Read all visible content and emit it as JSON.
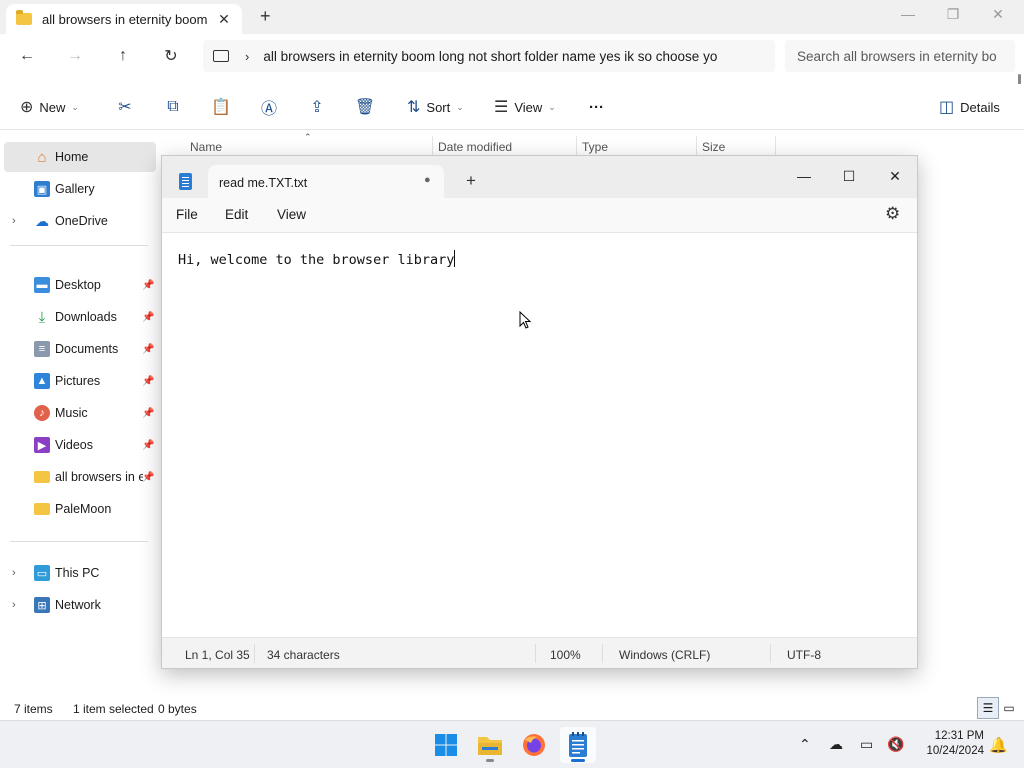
{
  "explorer": {
    "tab_title": "all browsers in eternity boom l",
    "tab_close": "✕",
    "new_tab": "+",
    "nav": {
      "back": "←",
      "forward": "→",
      "up": "↑",
      "refresh": "↻"
    },
    "address_path": "all browsers in eternity boom long not short folder name yes ik so choose yo",
    "search_placeholder": "Search all browsers in eternity bo",
    "toolbar": {
      "new_label": "New",
      "sort_label": "Sort",
      "view_label": "View",
      "more_label": "···",
      "details_label": "Details"
    },
    "sidebar": {
      "items": [
        {
          "label": "Home",
          "icon": "home-icon"
        },
        {
          "label": "Gallery",
          "icon": "gallery-icon"
        },
        {
          "label": "OneDrive",
          "icon": "onedrive-icon"
        },
        {
          "label": "Desktop",
          "icon": "desktop-icon"
        },
        {
          "label": "Downloads",
          "icon": "downloads-icon"
        },
        {
          "label": "Documents",
          "icon": "documents-icon"
        },
        {
          "label": "Pictures",
          "icon": "pictures-icon"
        },
        {
          "label": "Music",
          "icon": "music-icon"
        },
        {
          "label": "Videos",
          "icon": "videos-icon"
        },
        {
          "label": "all browsers in eternity boom long not short folder name yes ik so choose yo",
          "icon": "folder-icon"
        },
        {
          "label": "PaleMoon",
          "icon": "folder-icon"
        },
        {
          "label": "This PC",
          "icon": "this-pc-icon"
        },
        {
          "label": "Network",
          "icon": "network-icon"
        }
      ]
    },
    "columns": [
      "Name",
      "Date modified",
      "Type",
      "Size"
    ],
    "status": {
      "items": "7 items",
      "selected": "1 item selected",
      "size": "0 bytes"
    }
  },
  "notepad": {
    "tab_title": "read me.TXT.txt",
    "unsaved_dot": "●",
    "new_tab": "+",
    "menus": [
      "File",
      "Edit",
      "View"
    ],
    "content": "Hi, welcome to the browser library",
    "status": {
      "position": "Ln 1, Col 35",
      "characters": "34 characters",
      "zoom": "100%",
      "line_endings": "Windows (CRLF)",
      "encoding": "UTF-8"
    }
  },
  "taskbar": {
    "time": "12:31 PM",
    "date": "10/24/2024"
  },
  "colors": {
    "accent": "#1a6fd0",
    "folder": "#f4c542",
    "notepad": "#2b7cd3"
  }
}
